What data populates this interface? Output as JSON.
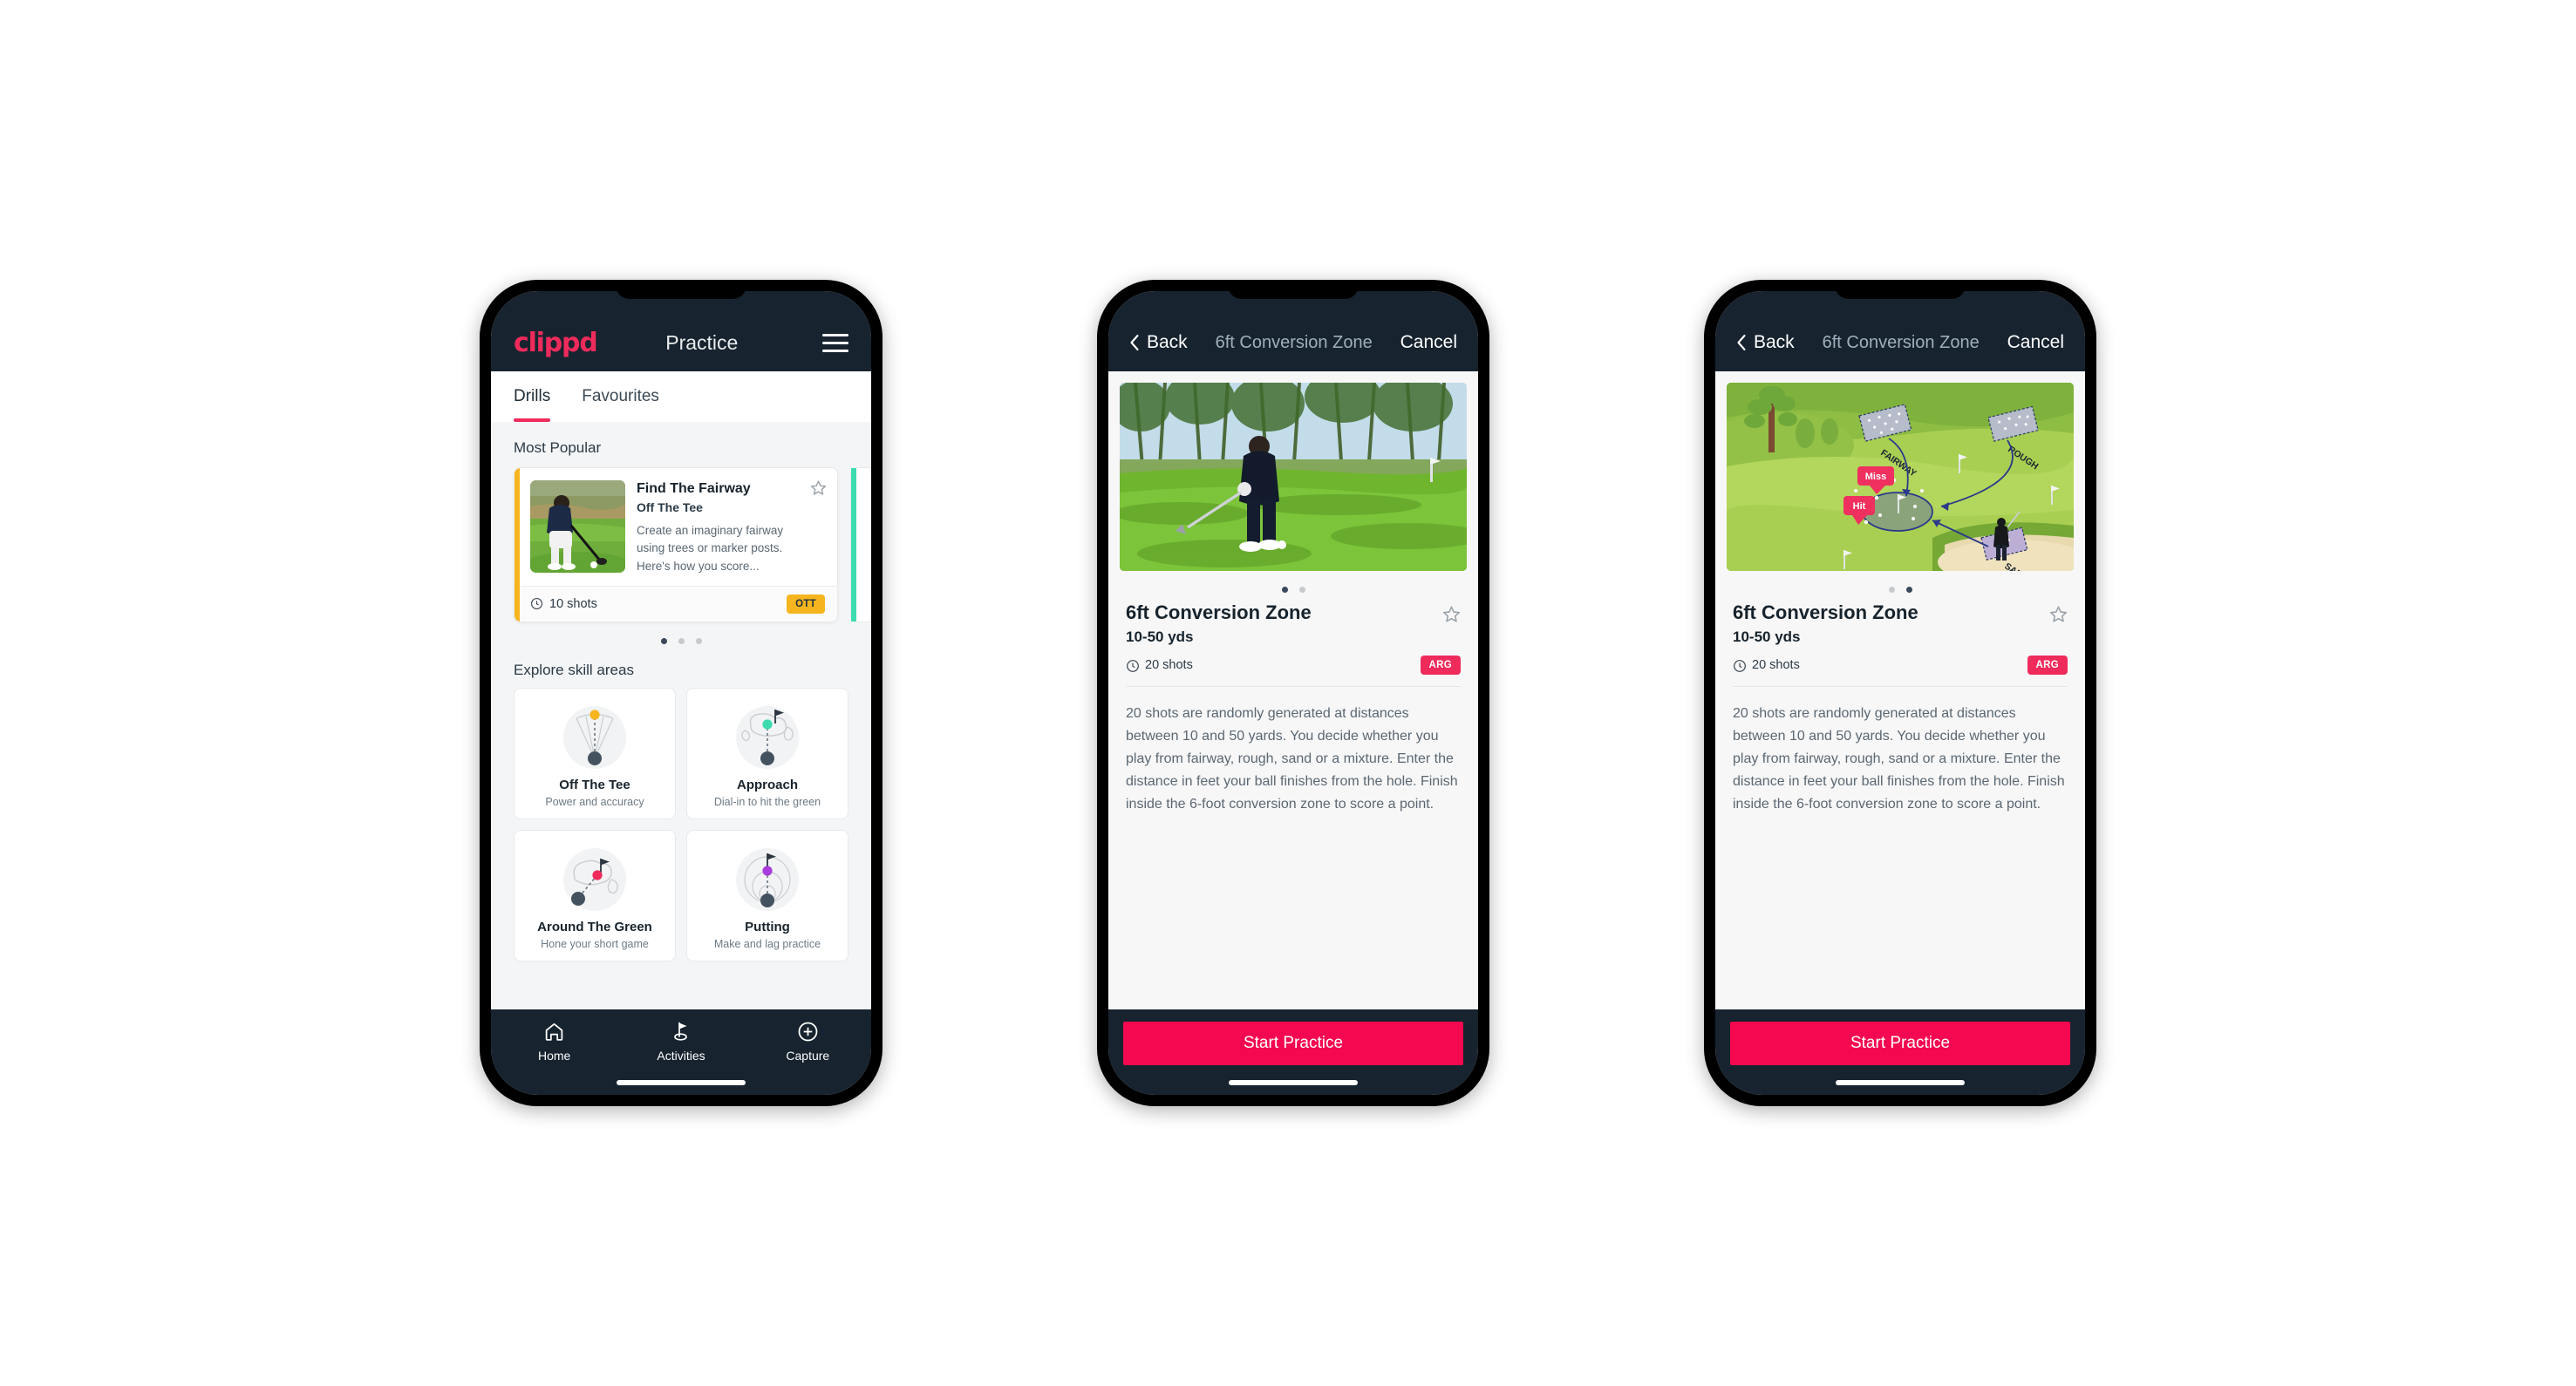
{
  "app": {
    "brand": "clippd",
    "accent_pink": "#ef2b5c",
    "accent_navy": "#17232e",
    "accent_amber": "#f6b51e",
    "accent_teal": "#3ddcb0"
  },
  "phone1": {
    "header": {
      "title": "Practice",
      "menu_icon": "hamburger-icon",
      "logo": "clippd"
    },
    "tabs": [
      {
        "label": "Drills",
        "active": true
      },
      {
        "label": "Favourites",
        "active": false
      }
    ],
    "most_popular": {
      "section_title": "Most Popular",
      "card": {
        "name": "Find The Fairway",
        "category": "Off The Tee",
        "description": "Create an imaginary fairway using trees or marker posts. Here's how you score...",
        "shots": "10 shots",
        "badge": "OTT",
        "accent": "#f6b51e",
        "star_icon": "star-outline-icon",
        "clock_icon": "clock-icon"
      },
      "next_card_accent": "#3ddcb0",
      "dots": {
        "count": 3,
        "active": 0
      }
    },
    "skills": {
      "section_title": "Explore skill areas",
      "items": [
        {
          "name": "Off The Tee",
          "sub": "Power and accuracy",
          "icon": "tee-fan-icon",
          "dot_color": "#f6b51e"
        },
        {
          "name": "Approach",
          "sub": "Dial-in to hit the green",
          "icon": "approach-green-icon",
          "dot_color": "#3ddcb0"
        },
        {
          "name": "Around The Green",
          "sub": "Hone your short game",
          "icon": "chip-green-icon",
          "dot_color": "#ef2b5c"
        },
        {
          "name": "Putting",
          "sub": "Make and lag practice",
          "icon": "putting-rings-icon",
          "dot_color": "#a83ddb"
        }
      ]
    },
    "bottom_nav": [
      {
        "label": "Home",
        "icon": "home-icon",
        "active": false
      },
      {
        "label": "Activities",
        "icon": "golf-flag-icon",
        "active": true
      },
      {
        "label": "Capture",
        "icon": "plus-circle-icon",
        "active": false
      }
    ]
  },
  "phone2": {
    "header": {
      "back": "Back",
      "title": "6ft Conversion Zone",
      "cancel": "Cancel",
      "back_icon": "chevron-left-icon"
    },
    "hero": {
      "type": "photo",
      "alt": "golfer chipping on pine-lined course"
    },
    "dots": {
      "count": 2,
      "active": 0
    },
    "detail": {
      "name": "6ft Conversion Zone",
      "yards": "10-50 yds",
      "shots": "20 shots",
      "badge": "ARG",
      "star_icon": "star-outline-icon",
      "clock_icon": "clock-icon",
      "description": "20 shots are randomly generated at distances between 10 and 50 yards. You decide whether you play from fairway, rough, sand or a mixture. Enter the distance in feet your ball finishes from the hole. Finish inside the 6-foot conversion zone to score a point."
    },
    "footer": {
      "start_label": "Start Practice"
    }
  },
  "phone3": {
    "header": {
      "back": "Back",
      "title": "6ft Conversion Zone",
      "cancel": "Cancel",
      "back_icon": "chevron-left-icon"
    },
    "hero": {
      "type": "illustration",
      "labels": {
        "fairway": "FAIRWAY",
        "rough": "ROUGH",
        "sand": "SAND"
      },
      "callouts": {
        "miss": "Miss",
        "hit": "Hit"
      }
    },
    "dots": {
      "count": 2,
      "active": 1
    },
    "detail": {
      "name": "6ft Conversion Zone",
      "yards": "10-50 yds",
      "shots": "20 shots",
      "badge": "ARG",
      "star_icon": "star-outline-icon",
      "clock_icon": "clock-icon",
      "description": "20 shots are randomly generated at distances between 10 and 50 yards. You decide whether you play from fairway, rough, sand or a mixture. Enter the distance in feet your ball finishes from the hole. Finish inside the 6-foot conversion zone to score a point."
    },
    "footer": {
      "start_label": "Start Practice"
    }
  }
}
